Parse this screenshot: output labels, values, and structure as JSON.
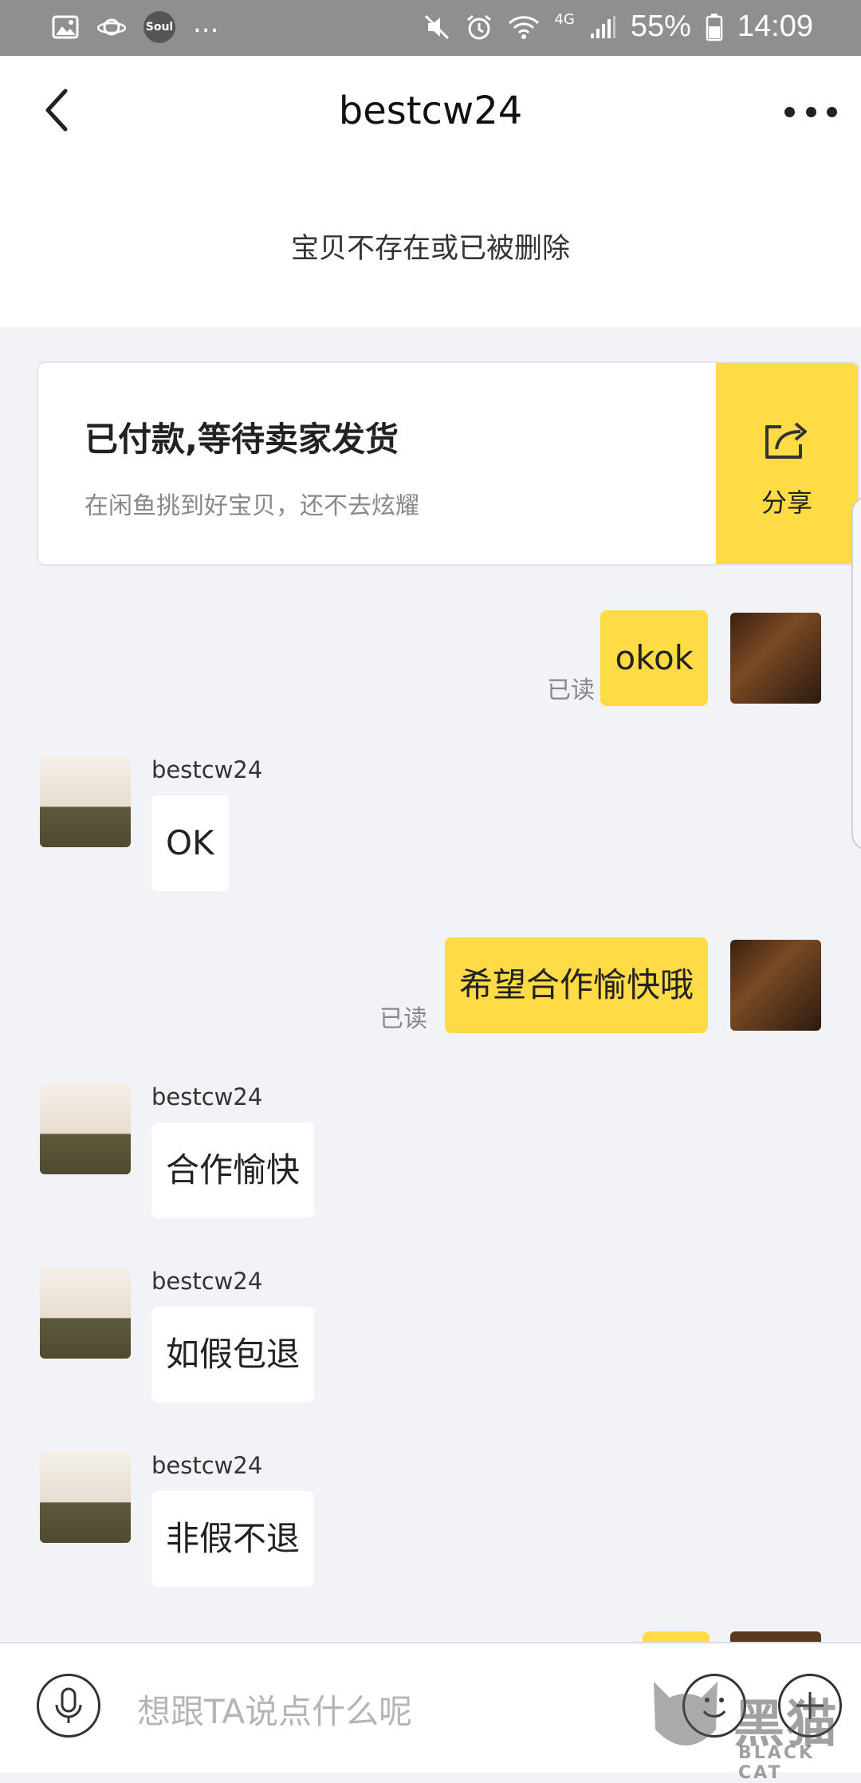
{
  "status_bar": {
    "battery": "55%",
    "time": "14:09",
    "network": "4G",
    "left_app_badge": "Soul",
    "overflow": "..."
  },
  "header": {
    "title": "bestcw24"
  },
  "notice": "宝贝不存在或已被删除",
  "order_card": {
    "title": "已付款,等待卖家发货",
    "subtitle": "在闲鱼挑到好宝贝，还不去炫耀",
    "share_label": "分享"
  },
  "messages": [
    {
      "side": "me",
      "text": "okok",
      "status": "已读"
    },
    {
      "side": "them",
      "sender": "bestcw24",
      "text": "OK"
    },
    {
      "side": "me",
      "text": "希望合作愉快哦",
      "status": "已读"
    },
    {
      "side": "them",
      "sender": "bestcw24",
      "text": "合作愉快"
    },
    {
      "side": "them",
      "sender": "bestcw24",
      "text": "如假包退"
    },
    {
      "side": "them",
      "sender": "bestcw24",
      "text": "非假不退"
    }
  ],
  "input_bar": {
    "placeholder": "想跟TA说点什么呢"
  },
  "watermark": {
    "text": "黑猫",
    "sub": "BLACK CAT"
  },
  "colors": {
    "accent": "#ffdb45",
    "background": "#f2f3f7"
  }
}
